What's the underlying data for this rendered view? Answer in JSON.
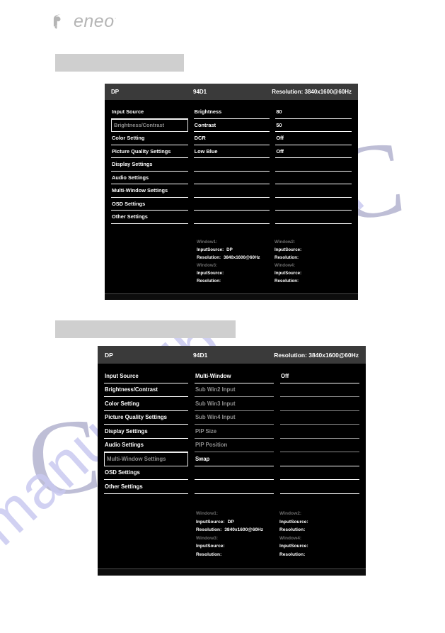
{
  "brand": {
    "name": "eneo",
    "trademark": "·",
    "logo_color": "#b5b5b5"
  },
  "watermark": {
    "text_left": "manualslib",
    "text_right": ".com",
    "color": "#c9c9f0"
  },
  "captions": {
    "caption_1": "",
    "caption_2": ""
  },
  "osd_menus": [
    {
      "id": "brightness-contrast-menu",
      "header": {
        "input_source": "DP",
        "model": "94D1",
        "resolution": "Resolution: 3840x1600@60Hz"
      },
      "menu_items": [
        {
          "label": "Input Source",
          "state": "normal"
        },
        {
          "label": "Brightness/Contrast",
          "state": "selected"
        },
        {
          "label": "Color Setting",
          "state": "normal"
        },
        {
          "label": "Picture Quality Settings",
          "state": "normal"
        },
        {
          "label": "Display Settings",
          "state": "normal"
        },
        {
          "label": "Audio Settings",
          "state": "normal"
        },
        {
          "label": "Multi-Window Settings",
          "state": "normal"
        },
        {
          "label": "OSD Settings",
          "state": "normal"
        },
        {
          "label": "Other Settings",
          "state": "normal"
        }
      ],
      "sub_items": [
        {
          "label": "Brightness",
          "value": "80",
          "state": "normal"
        },
        {
          "label": "Contrast",
          "value": "50",
          "state": "normal"
        },
        {
          "label": "DCR",
          "value": "Off",
          "state": "normal"
        },
        {
          "label": "Low Blue",
          "value": "Off",
          "state": "normal"
        },
        {
          "label": "",
          "value": "",
          "state": "blank"
        },
        {
          "label": "",
          "value": "",
          "state": "blank"
        },
        {
          "label": "",
          "value": "",
          "state": "blank"
        },
        {
          "label": "",
          "value": "",
          "state": "blank"
        },
        {
          "label": "",
          "value": "",
          "state": "blank"
        }
      ],
      "window_info": [
        {
          "title": "Window1:",
          "input_source_label": "InputSource:",
          "input_source_value": "DP",
          "resolution_label": "Resolution:",
          "resolution_value": "3840x1600@60Hz"
        },
        {
          "title": "Window2:",
          "input_source_label": "InputSource:",
          "input_source_value": "",
          "resolution_label": "Resolution:",
          "resolution_value": ""
        },
        {
          "title": "Window3:",
          "input_source_label": "InputSource:",
          "input_source_value": "",
          "resolution_label": "Resolution:",
          "resolution_value": ""
        },
        {
          "title": "Window4:",
          "input_source_label": "InputSource:",
          "input_source_value": "",
          "resolution_label": "Resolution:",
          "resolution_value": ""
        }
      ]
    },
    {
      "id": "multi-window-menu",
      "header": {
        "input_source": "DP",
        "model": "94D1",
        "resolution": "Resolution: 3840x1600@60Hz"
      },
      "menu_items": [
        {
          "label": "Input Source",
          "state": "normal"
        },
        {
          "label": "Brightness/Contrast",
          "state": "normal"
        },
        {
          "label": "Color Setting",
          "state": "normal"
        },
        {
          "label": "Picture Quality Settings",
          "state": "normal"
        },
        {
          "label": "Display Settings",
          "state": "normal"
        },
        {
          "label": "Audio Settings",
          "state": "normal"
        },
        {
          "label": "Multi-Window Settings",
          "state": "selected"
        },
        {
          "label": "OSD Settings",
          "state": "normal"
        },
        {
          "label": "Other Settings",
          "state": "normal"
        }
      ],
      "sub_items": [
        {
          "label": "Multi-Window",
          "value": "Off",
          "state": "normal"
        },
        {
          "label": "Sub Win2 Input",
          "value": "",
          "state": "dim"
        },
        {
          "label": "Sub Win3 Input",
          "value": "",
          "state": "dim"
        },
        {
          "label": "Sub Win4 Input",
          "value": "",
          "state": "dim"
        },
        {
          "label": "PIP Size",
          "value": "",
          "state": "dim"
        },
        {
          "label": "PIP Position",
          "value": "",
          "state": "dim"
        },
        {
          "label": "Swap",
          "value": "",
          "state": "normal"
        },
        {
          "label": "",
          "value": "",
          "state": "blank"
        },
        {
          "label": "",
          "value": "",
          "state": "blank"
        }
      ],
      "window_info": [
        {
          "title": "Window1:",
          "input_source_label": "InputSource:",
          "input_source_value": "DP",
          "resolution_label": "Resolution:",
          "resolution_value": "3840x1600@60Hz"
        },
        {
          "title": "Window2:",
          "input_source_label": "InputSource:",
          "input_source_value": "",
          "resolution_label": "Resolution:",
          "resolution_value": ""
        },
        {
          "title": "Window3:",
          "input_source_label": "InputSource:",
          "input_source_value": "",
          "resolution_label": "Resolution:",
          "resolution_value": ""
        },
        {
          "title": "Window4:",
          "input_source_label": "InputSource:",
          "input_source_value": "",
          "resolution_label": "Resolution:",
          "resolution_value": ""
        }
      ]
    }
  ]
}
